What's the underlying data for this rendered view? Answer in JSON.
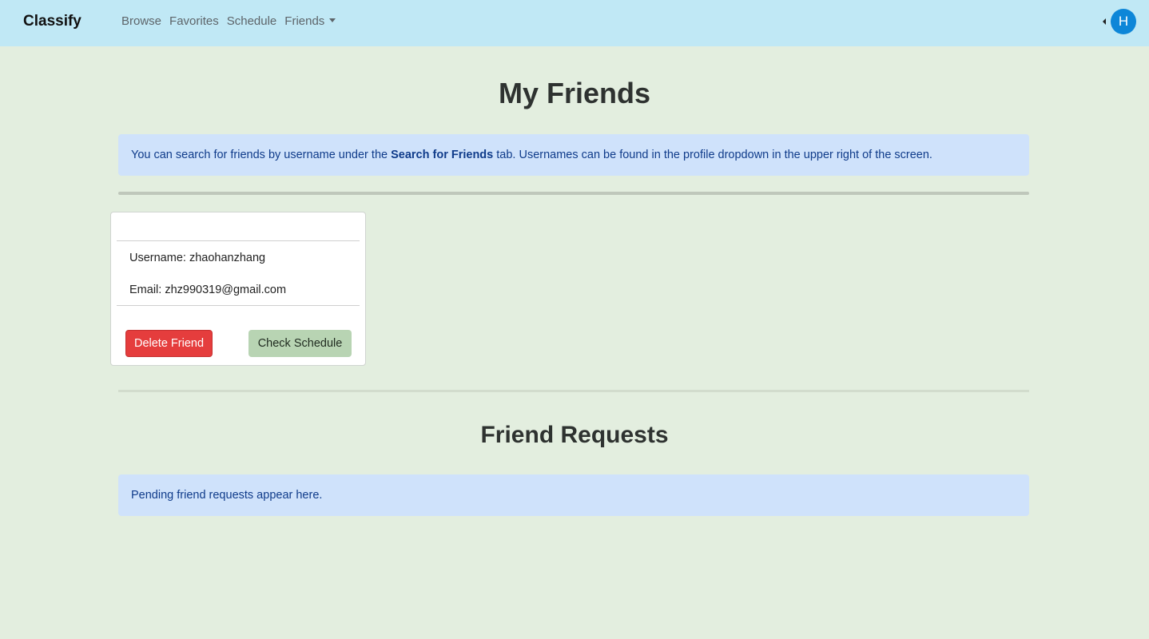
{
  "navbar": {
    "brand": "Classify",
    "links": [
      "Browse",
      "Favorites",
      "Schedule",
      "Friends"
    ],
    "avatar_initial": "H",
    "bg_color": "#c0e8f5",
    "avatar_color": "#0d86d8"
  },
  "main": {
    "title": "My Friends",
    "info_alert": {
      "before": "You can search for friends by username under the ",
      "bold": "Search for Friends",
      "after": " tab. Usernames can be found in the profile dropdown in the upper right of the screen."
    },
    "friend_card": {
      "username_line": "Username: zhaohanzhang",
      "email_line": "Email: zhz990319@gmail.com",
      "delete_label": "Delete Friend",
      "schedule_label": "Check Schedule"
    },
    "requests_title": "Friend Requests",
    "requests_alert": "Pending friend requests appear here."
  },
  "colors": {
    "page_bg": "#e3eedf",
    "alert_bg": "#cfe2fb",
    "danger": "#e53d3d",
    "schedule_btn": "#b8d4b3"
  }
}
